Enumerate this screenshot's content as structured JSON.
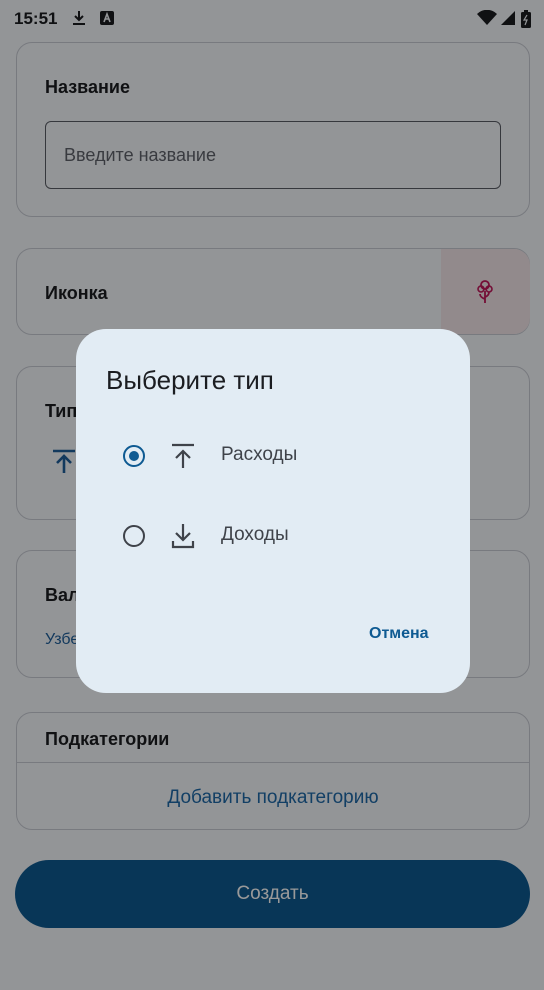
{
  "status_bar": {
    "time": "15:51",
    "icons": [
      "download-icon",
      "a-notification-icon",
      "wifi-icon",
      "signal-icon",
      "battery-icon"
    ]
  },
  "form": {
    "name": {
      "label": "Название",
      "placeholder": "Введите название"
    },
    "icon": {
      "label": "Иконка",
      "icon_name": "flower-icon"
    },
    "type": {
      "label": "Тип"
    },
    "currency": {
      "label": "Валюта",
      "value": "Узбекский сум"
    },
    "subcategories": {
      "label": "Подкатегории",
      "add_label": "Добавить подкатегорию"
    },
    "create_label": "Создать"
  },
  "dialog": {
    "title": "Выберите тип",
    "options": [
      {
        "label": "Расходы",
        "selected": true,
        "icon": "upload-icon"
      },
      {
        "label": "Доходы",
        "selected": false,
        "icon": "download-icon"
      }
    ],
    "cancel_label": "Отмена"
  },
  "colors": {
    "primary": "#0e5a92",
    "dialog_bg": "#e2ecf4",
    "page_bg": "#f6f8fc",
    "icon_tint": "#c2185b"
  }
}
